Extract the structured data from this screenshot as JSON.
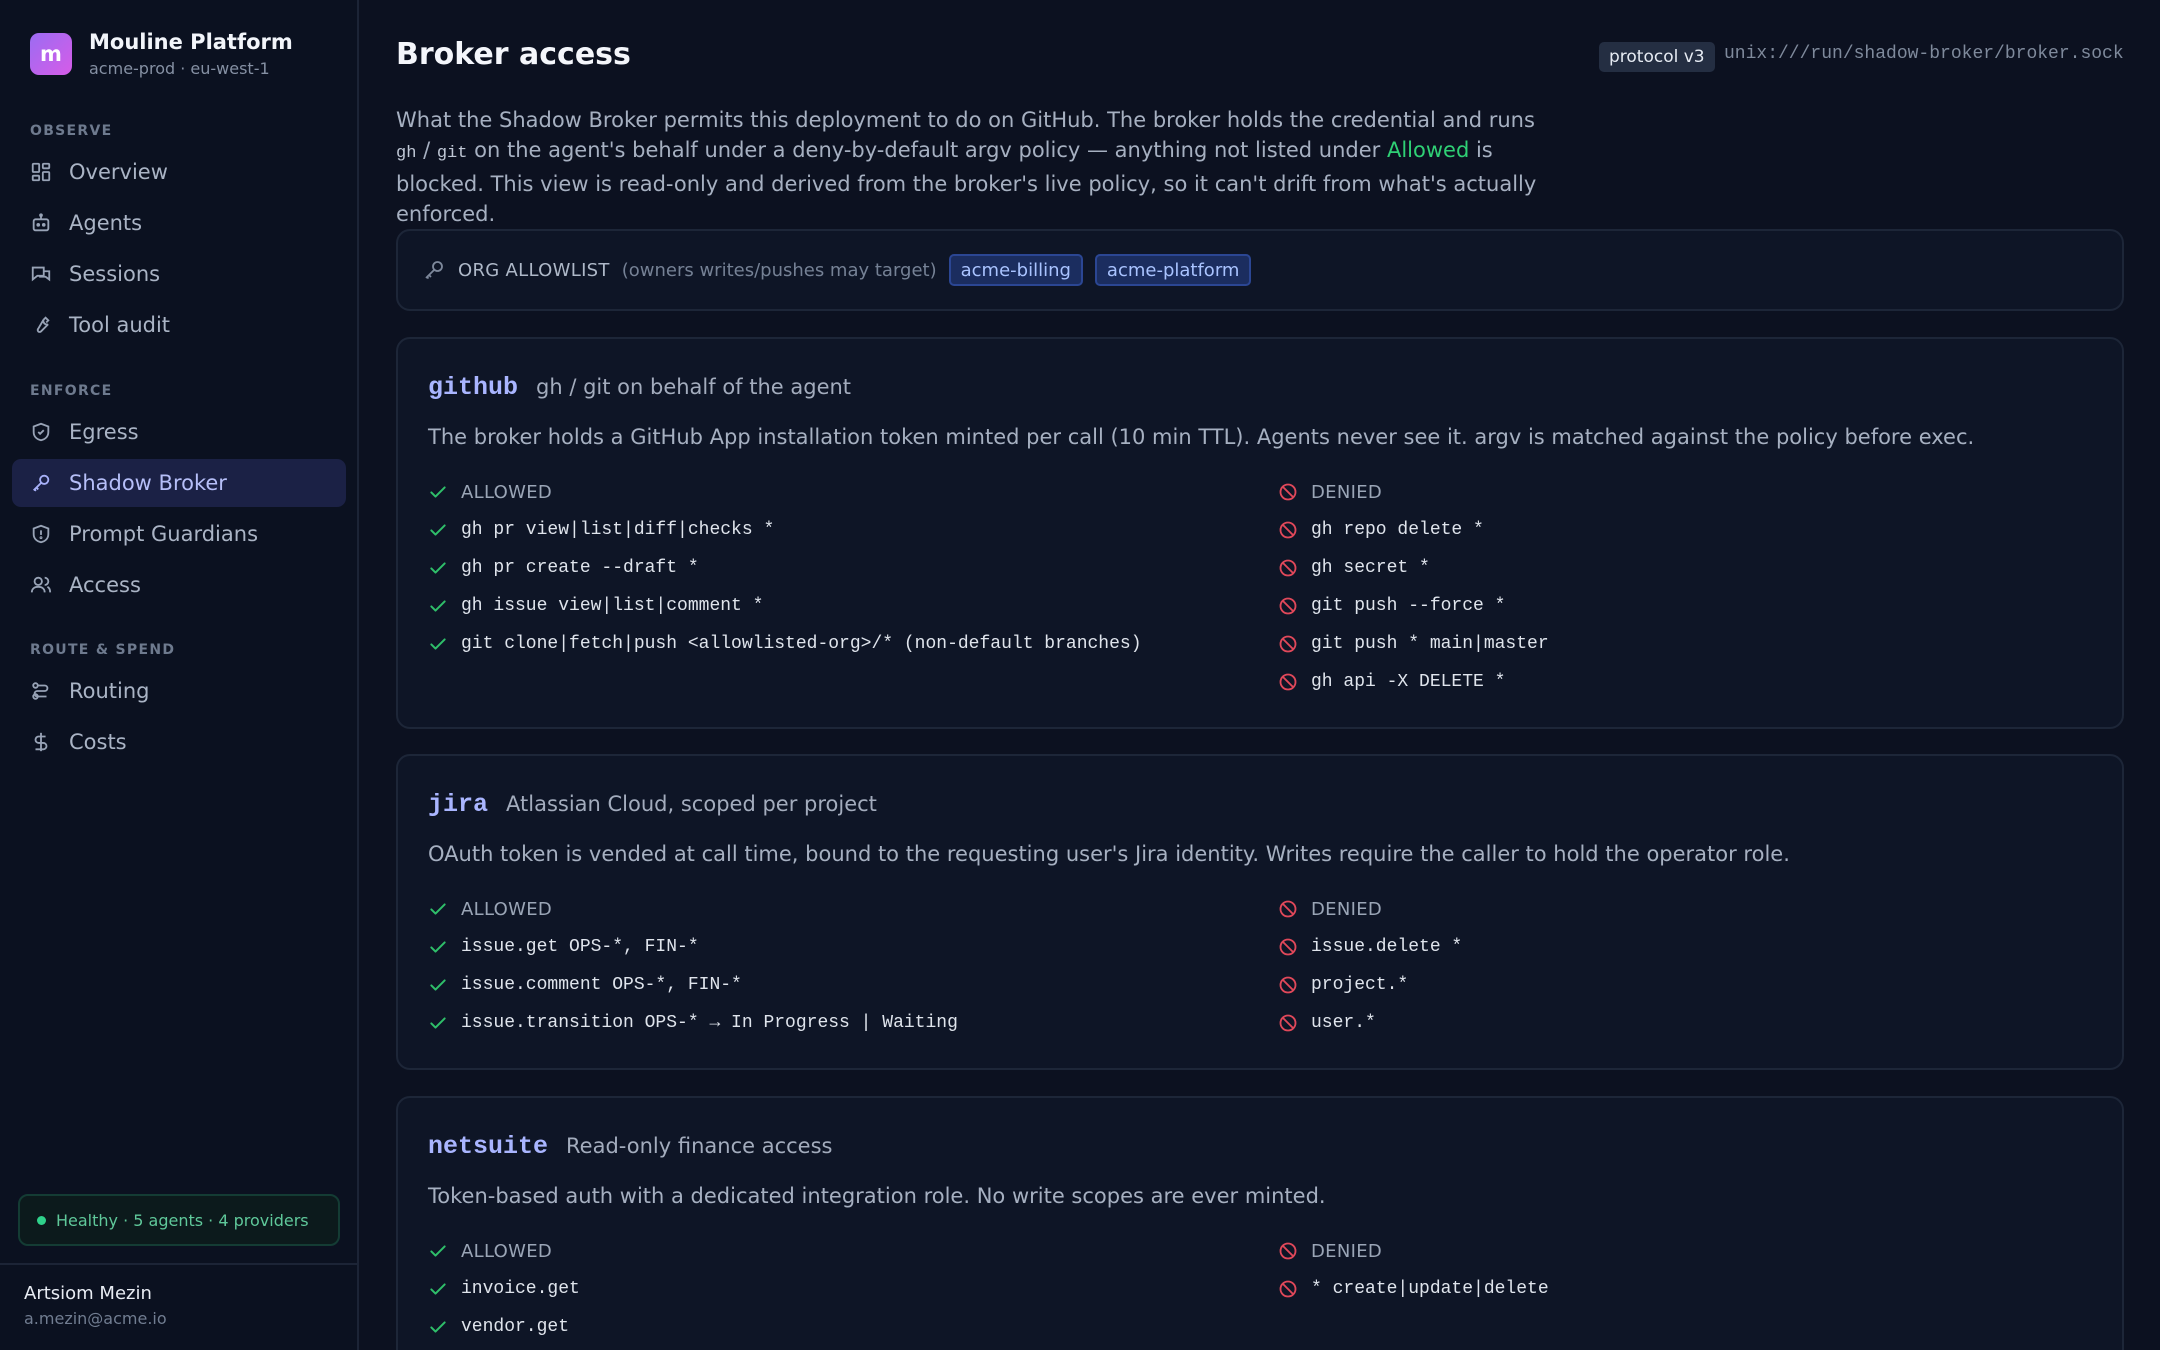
{
  "brand": {
    "logo_letter": "m",
    "title": "Mouline Platform",
    "subtitle": "acme-prod · eu-west-1"
  },
  "nav": {
    "sections": [
      {
        "label": "OBSERVE",
        "items": [
          {
            "label": "Overview",
            "icon": "grid-icon"
          },
          {
            "label": "Agents",
            "icon": "bot-icon"
          },
          {
            "label": "Sessions",
            "icon": "chat-icon"
          },
          {
            "label": "Tool audit",
            "icon": "wrench-icon"
          }
        ]
      },
      {
        "label": "ENFORCE",
        "items": [
          {
            "label": "Egress",
            "icon": "shield-check-icon"
          },
          {
            "label": "Shadow Broker",
            "icon": "key-icon",
            "active": true
          },
          {
            "label": "Prompt Guardians",
            "icon": "shield-icon"
          },
          {
            "label": "Access",
            "icon": "users-icon"
          }
        ]
      },
      {
        "label": "ROUTE & SPEND",
        "items": [
          {
            "label": "Routing",
            "icon": "route-icon"
          },
          {
            "label": "Costs",
            "icon": "dollar-icon"
          }
        ]
      }
    ]
  },
  "health": {
    "text": "Healthy · 5 agents · 4 providers",
    "color": "#2fd18b"
  },
  "user": {
    "name": "Artsiom Mezin",
    "email": "a.mezin@acme.io"
  },
  "page": {
    "title": "Broker access",
    "protocol": "protocol v3",
    "socket": "unix:///run/shadow-broker/broker.sock",
    "intro": {
      "p1": "What the Shadow Broker permits this deployment to do on GitHub. The broker holds the credential and runs ",
      "code1": "gh",
      "sep": " / ",
      "code2": "git",
      "p2": " on the agent's behalf under a deny-by-default argv policy — anything not listed under ",
      "allowed_word": "Allowed",
      "p3": " is blocked. This view is read-only and derived from the broker's live policy, so it can't drift from what's actually enforced."
    }
  },
  "org_allowlist": {
    "label": "ORG ALLOWLIST",
    "hint": "(owners writes/pushes may target)",
    "orgs": [
      "acme-billing",
      "acme-platform"
    ]
  },
  "labels": {
    "allowed": "ALLOWED",
    "denied": "DENIED"
  },
  "services": [
    {
      "name": "github",
      "subtitle": "gh / git on behalf of the agent",
      "description": "The broker holds a GitHub App installation token minted per call (10 min TTL). Agents never see it. argv is matched against the policy before exec.",
      "allowed": [
        "gh pr view|list|diff|checks *",
        "gh pr create --draft *",
        "gh issue view|list|comment *",
        "git clone|fetch|push <allowlisted-org>/* (non-default branches)"
      ],
      "denied": [
        "gh repo delete *",
        "gh secret *",
        "git push --force *",
        "git push * main|master",
        "gh api -X DELETE *"
      ]
    },
    {
      "name": "jira",
      "subtitle": "Atlassian Cloud, scoped per project",
      "description": "OAuth token is vended at call time, bound to the requesting user's Jira identity. Writes require the caller to hold the operator role.",
      "allowed": [
        "issue.get OPS-*, FIN-*",
        "issue.comment OPS-*, FIN-*",
        "issue.transition OPS-* → In Progress | Waiting"
      ],
      "denied": [
        "issue.delete *",
        "project.*",
        "user.*"
      ]
    },
    {
      "name": "netsuite",
      "subtitle": "Read-only finance access",
      "description": "Token-based auth with a dedicated integration role. No write scopes are ever minted.",
      "allowed": [
        "invoice.get",
        "vendor.get"
      ],
      "denied": [
        "* create|update|delete"
      ]
    }
  ]
}
